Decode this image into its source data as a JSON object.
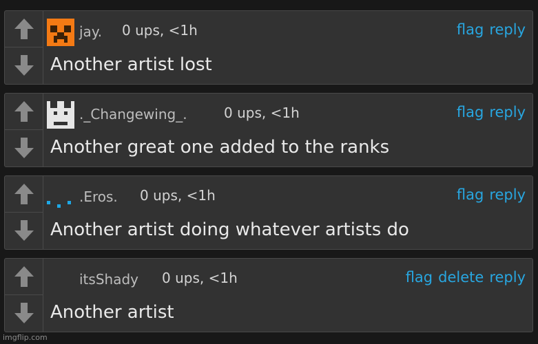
{
  "comments": [
    {
      "username": "jay.",
      "meta": "0 ups, <1h",
      "actions": [
        "flag",
        "reply"
      ],
      "text": "Another artist lost",
      "avatar": "orange-creeper-avatar"
    },
    {
      "username": "._Changewing_.",
      "meta": "0 ups, <1h",
      "actions": [
        "flag",
        "reply"
      ],
      "text": "Another great one added to the ranks",
      "avatar": "white-pixel-face-avatar"
    },
    {
      "username": ".Eros.",
      "meta": "0 ups, <1h",
      "actions": [
        "flag",
        "reply"
      ],
      "text": "Another artist doing whatever artists do",
      "avatar": "blue-dots-avatar"
    },
    {
      "username": "itsShady",
      "meta": "0 ups, <1h",
      "actions": [
        "flag",
        "delete",
        "reply"
      ],
      "text": "Another artist",
      "avatar": "none"
    }
  ],
  "watermark": "imgflip.com",
  "colors": {
    "link": "#28a6e0",
    "background": "#181818",
    "panel": "#323232",
    "avatar_orange": "#f47a14",
    "avatar_blue": "#1ea8e6"
  }
}
